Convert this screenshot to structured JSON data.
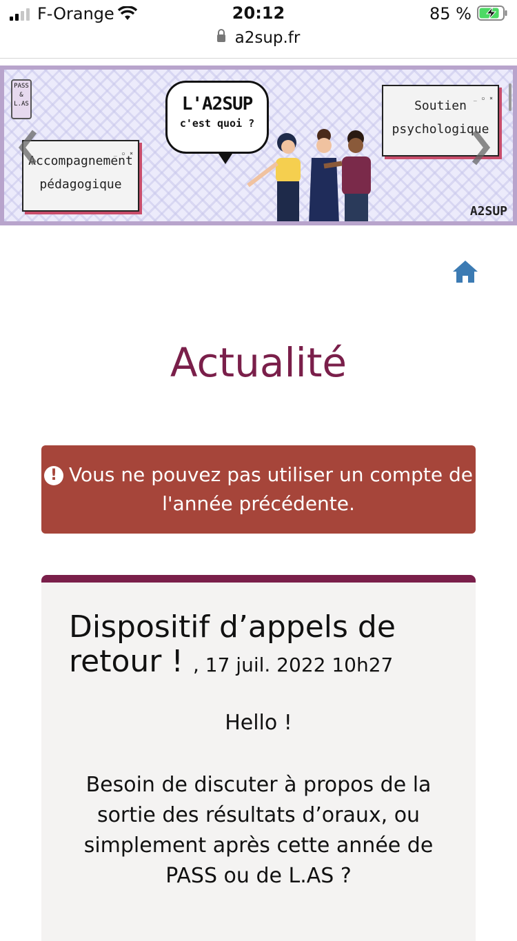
{
  "status_bar": {
    "carrier": "F-Orange",
    "time": "20:12",
    "battery_percent": "85 %",
    "battery_level": 0.85,
    "battery_color": "#4cd964",
    "icons": [
      "signal-icon",
      "wifi-icon",
      "battery-charging-icon"
    ]
  },
  "browser": {
    "url": "a2sup.fr",
    "icons": [
      "lock-icon"
    ]
  },
  "banner": {
    "tag_lines": [
      "PASS",
      "&",
      "L.AS"
    ],
    "bubble_title": "L'A2SUP",
    "bubble_subtitle": "c'est quoi ?",
    "left_card_lines": [
      "Accompagnement",
      "pédagogique"
    ],
    "right_card_lines": [
      "Soutien",
      "psychologique"
    ],
    "logo": "A2SUP",
    "icons": [
      "chevron-left-icon",
      "chevron-right-icon"
    ]
  },
  "nav": {
    "home_icon": "home-icon",
    "home_color": "#3c7bb3"
  },
  "page": {
    "title": "Actualité",
    "title_color": "#7a1f4a"
  },
  "alert": {
    "icon": "exclamation-circle-icon",
    "text": "Vous ne pouvez pas utiliser un compte de l'année précédente.",
    "bg_color": "#a6453a"
  },
  "news": {
    "title": "Dispositif d’appels de retour !",
    "date": ", 17 juil. 2022 10h27",
    "greeting": "Hello !",
    "body": "Besoin de discuter à propos de la sortie des résultats d’oraux, ou simplement après cette année de PASS ou de L.AS ?",
    "accent_color": "#7a1f4a"
  }
}
